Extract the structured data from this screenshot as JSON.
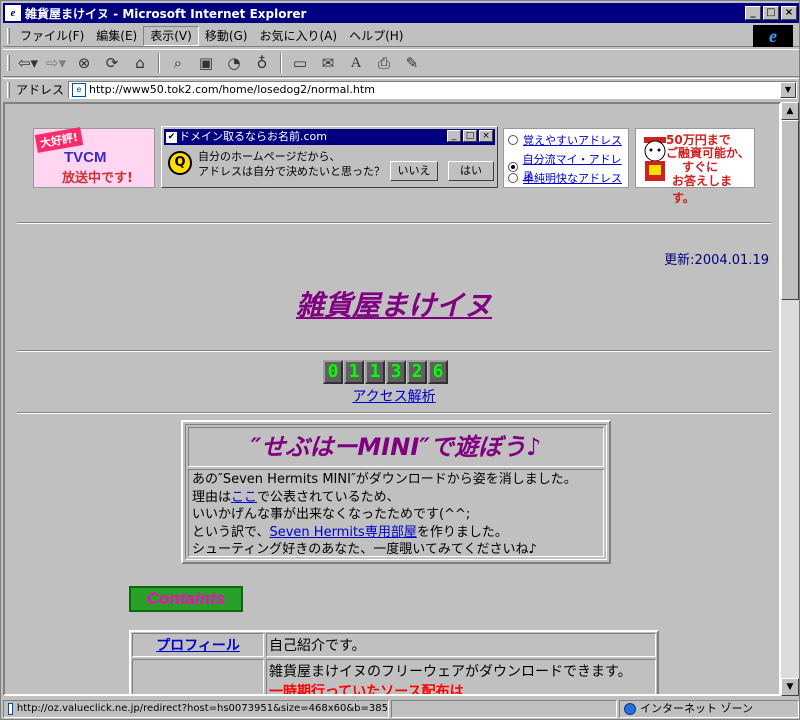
{
  "window": {
    "title": "雑貨屋まけイヌ - Microsoft Internet Explorer",
    "controls": [
      "_",
      "□",
      "×"
    ]
  },
  "menu": [
    "ファイル(F)",
    "編集(E)",
    "表示(V)",
    "移動(G)",
    "お気に入り(A)",
    "ヘルプ(H)"
  ],
  "toolbar": {
    "buttons": [
      "back-icon",
      "forward-icon",
      "stop-icon",
      "refresh-icon",
      "home-icon",
      "search-icon",
      "favorites-icon",
      "history-icon",
      "channels-icon",
      "fullscreen-icon",
      "mail-icon",
      "font-icon",
      "print-icon",
      "edit-icon"
    ]
  },
  "address": {
    "label": "アドレス",
    "url": "http://www50.tok2.com/home/losedog2/normal.htm"
  },
  "ads": {
    "ad1": {
      "tag": "大好評!",
      "line1": "TVCM",
      "line2": "放送中です!"
    },
    "ad2": {
      "title": "ドメイン取るならお名前.com",
      "q": "Q",
      "text1": "自分のホームページだから、",
      "text2": "アドレスは自分で決めたいと思った？",
      "no": "いいえ",
      "yes": "はい"
    },
    "ad3": {
      "options": [
        "覚えやすいアドレス",
        "自分流マイ・アドレス",
        "単純明快なアドレス"
      ],
      "selected": 1
    },
    "ad4": {
      "line1": "50万円まで",
      "line2": "ご融資可能か、",
      "line3": "すぐに",
      "line4": "お答えします。"
    }
  },
  "page": {
    "updated": "更新:2004.01.19",
    "site_title": "雑貨屋まけイヌ",
    "counter": [
      "0",
      "1",
      "1",
      "3",
      "2",
      "6"
    ],
    "access_link": "アクセス解析",
    "notice_title": "″せぶはーMINI″で遊ぼう♪",
    "notice_line1": "あの″Seven Hermits MINI″がダウンロードから姿を消しました。",
    "notice_line2_pre": "理由は",
    "notice_line2_link": "ここ",
    "notice_line2_post": "で公表されているため、",
    "notice_line3": "いいかげんな事が出来なくなったためです(^^;",
    "notice_line4_pre": "という訳で、",
    "notice_line4_link": "Seven Hermits専用部屋",
    "notice_line4_post": "を作りました。",
    "notice_line5": "シューティング好きのあなた、一度覗いてみてくださいね♪",
    "contents_label": "Containts",
    "table": [
      {
        "link": "プロフィール",
        "desc": "自己紹介です。"
      },
      {
        "link": "",
        "desc": "雑貨屋まけイヌのフリーウェアがダウンロードできます。",
        "desc_red": "一時期行っていたソース配布は"
      }
    ]
  },
  "status": {
    "url": "http://oz.valueclick.ne.jp/redirect?host=hs0073951&size=468x60&b=385",
    "zone": "インターネット ゾーン"
  }
}
